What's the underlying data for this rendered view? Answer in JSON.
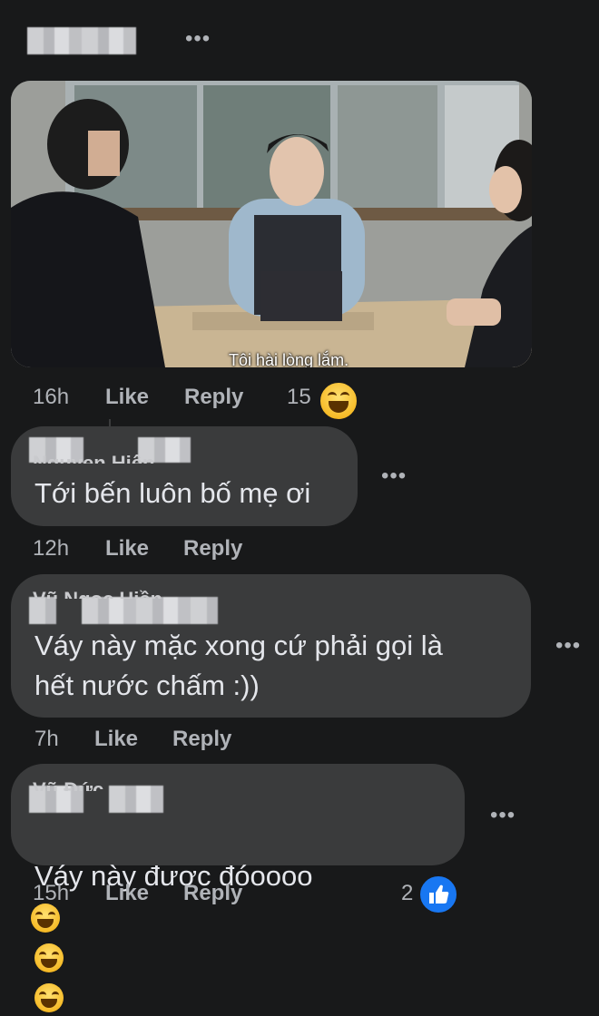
{
  "post": {
    "subtitle": "Tôi hài lòng lắm.",
    "time": "16h",
    "like_label": "Like",
    "reply_label": "Reply",
    "reaction_count": "15",
    "reaction_icon": "haha-emoji-icon"
  },
  "comments": [
    {
      "author": "Nguyen Hiên",
      "text": "Tới bến luôn bố mẹ ơi",
      "time": "12h",
      "like_label": "Like",
      "reply_label": "Reply"
    },
    {
      "author": "Vũ Ngọc Hiền",
      "text": "Váy này mặc xong cứ phải gọi là\nhết nước chấm :))",
      "time": "7h",
      "like_label": "Like",
      "reply_label": "Reply"
    },
    {
      "author": "Vũ Đức",
      "text": "Váy này được đóoooo",
      "time": "15h",
      "like_label": "Like",
      "reply_label": "Reply",
      "reaction_count": "2",
      "reaction_icon": "like-thumb-icon"
    }
  ],
  "colors": {
    "background": "#18191a",
    "bubble": "#3a3b3c",
    "text": "#e4e6eb",
    "secondary_text": "#b0b3b8",
    "like_blue": "#1877f2"
  }
}
